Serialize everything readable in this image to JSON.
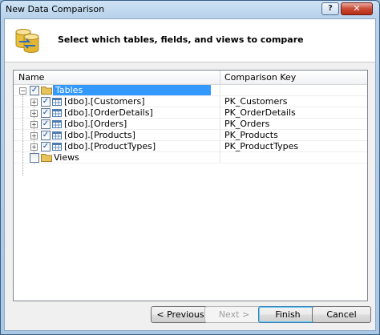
{
  "window": {
    "title": "New Data Comparison",
    "close_label": "✕",
    "help_label": "?"
  },
  "header": {
    "instruction": "Select which tables, fields, and views to compare"
  },
  "grid": {
    "columns": {
      "name": "Name",
      "key": "Comparison Key"
    },
    "groups": {
      "tables": {
        "label": "Tables",
        "checked": true,
        "expanded": true
      },
      "views": {
        "label": "Views",
        "checked": false,
        "expanded": false
      }
    },
    "tables": [
      {
        "name": "[dbo].[Customers]",
        "key": "PK_Customers",
        "checked": true
      },
      {
        "name": "[dbo].[OrderDetails]",
        "key": "PK_OrderDetails",
        "checked": true
      },
      {
        "name": "[dbo].[Orders]",
        "key": "PK_Orders",
        "checked": true
      },
      {
        "name": "[dbo].[Products]",
        "key": "PK_Products",
        "checked": true
      },
      {
        "name": "[dbo].[ProductTypes]",
        "key": "PK_ProductTypes",
        "checked": true
      }
    ]
  },
  "buttons": {
    "previous": "< Previous",
    "next": "Next >",
    "finish": "Finish",
    "cancel": "Cancel"
  },
  "colors": {
    "selection": "#3399ff",
    "folder": "#e8c25a",
    "title_close": "#c94b34"
  }
}
